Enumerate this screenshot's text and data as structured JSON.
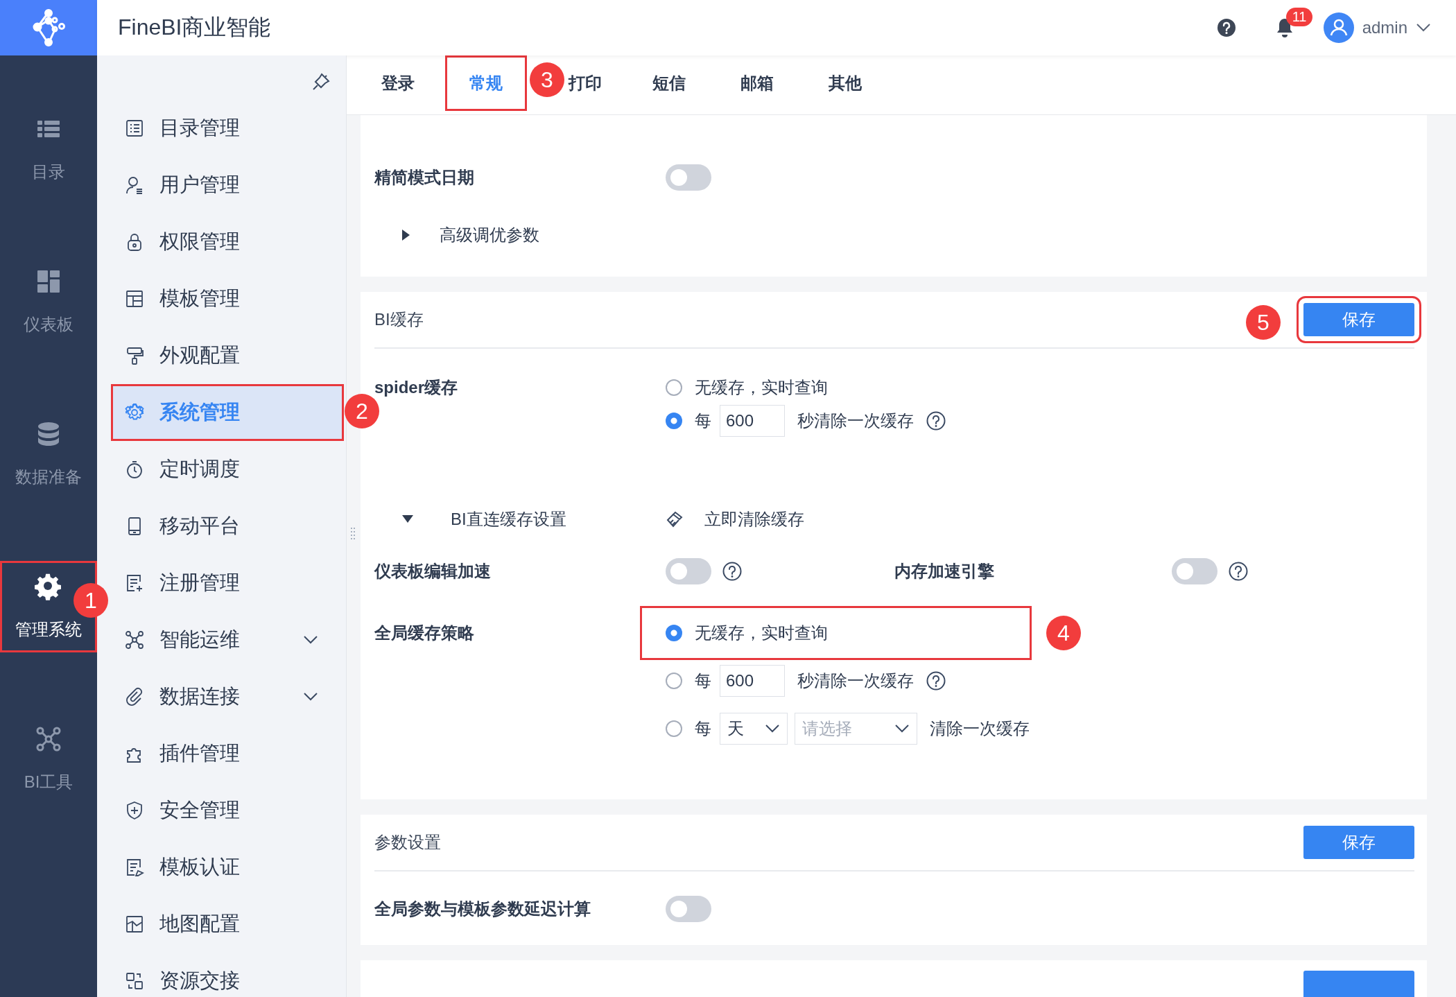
{
  "app": {
    "title": "FineBI商业智能"
  },
  "header": {
    "notification_count": "11",
    "user": "admin"
  },
  "rail": [
    {
      "label": "目录",
      "selected": false
    },
    {
      "label": "仪表板",
      "selected": false
    },
    {
      "label": "数据准备",
      "selected": false
    },
    {
      "label": "管理系统",
      "selected": true,
      "annotation": "1"
    },
    {
      "label": "BI工具",
      "selected": false
    }
  ],
  "sidebar": {
    "items": [
      {
        "label": "目录管理",
        "selected": false
      },
      {
        "label": "用户管理",
        "selected": false
      },
      {
        "label": "权限管理",
        "selected": false
      },
      {
        "label": "模板管理",
        "selected": false
      },
      {
        "label": "外观配置",
        "selected": false
      },
      {
        "label": "系统管理",
        "selected": true,
        "annotation": "2"
      },
      {
        "label": "定时调度",
        "selected": false
      },
      {
        "label": "移动平台",
        "selected": false
      },
      {
        "label": "注册管理",
        "selected": false
      },
      {
        "label": "智能运维",
        "selected": false,
        "expandable": true
      },
      {
        "label": "数据连接",
        "selected": false,
        "expandable": true
      },
      {
        "label": "插件管理",
        "selected": false
      },
      {
        "label": "安全管理",
        "selected": false
      },
      {
        "label": "模板认证",
        "selected": false
      },
      {
        "label": "地图配置",
        "selected": false
      },
      {
        "label": "资源交接",
        "selected": false
      }
    ]
  },
  "tabs": [
    {
      "label": "登录",
      "selected": false
    },
    {
      "label": "常规",
      "selected": true,
      "annotation": "3"
    },
    {
      "label": "打印",
      "selected": false
    },
    {
      "label": "短信",
      "selected": false
    },
    {
      "label": "邮箱",
      "selected": false
    },
    {
      "label": "其他",
      "selected": false
    }
  ],
  "sections": [
    {
      "rows": [
        {
          "kind": "toggle",
          "label": "精简模式日期",
          "on": false
        },
        {
          "kind": "expander",
          "label": "高级调优参数",
          "expanded": false
        }
      ]
    },
    {
      "title": "BI缓存",
      "save_button": {
        "label": "保存",
        "annotation": "5"
      },
      "rows": [
        {
          "kind": "radio",
          "label": "spider缓存",
          "options": [
            {
              "kind": "text",
              "text": "无缓存，实时查询",
              "selected": false
            },
            {
              "kind": "interval",
              "prefix": "每",
              "value": "600",
              "suffix": "秒清除一次缓存",
              "help": true,
              "selected": true
            }
          ]
        },
        {
          "kind": "expander_action",
          "label": "BI直连缓存设置",
          "expanded": true,
          "action": "立即清除缓存"
        },
        {
          "kind": "toggle_pair",
          "items": [
            {
              "label": "仪表板编辑加速",
              "on": false,
              "help": true
            },
            {
              "label": "内存加速引擎",
              "on": false,
              "help": true
            }
          ]
        },
        {
          "kind": "radio",
          "label": "全局缓存策略",
          "options": [
            {
              "kind": "text",
              "text": "无缓存，实时查询",
              "selected": true,
              "annotation": "4"
            },
            {
              "kind": "interval",
              "prefix": "每",
              "value": "600",
              "suffix": "秒清除一次缓存",
              "help": true,
              "selected": false
            },
            {
              "kind": "schedule",
              "prefix": "每",
              "unit": "天",
              "placeholder": "请选择",
              "suffix": "清除一次缓存",
              "selected": false
            }
          ]
        }
      ]
    },
    {
      "title": "参数设置",
      "save_button": {
        "label": "保存"
      },
      "rows": [
        {
          "kind": "toggle",
          "label": "全局参数与模板参数延迟计算",
          "on": false
        }
      ]
    }
  ]
}
